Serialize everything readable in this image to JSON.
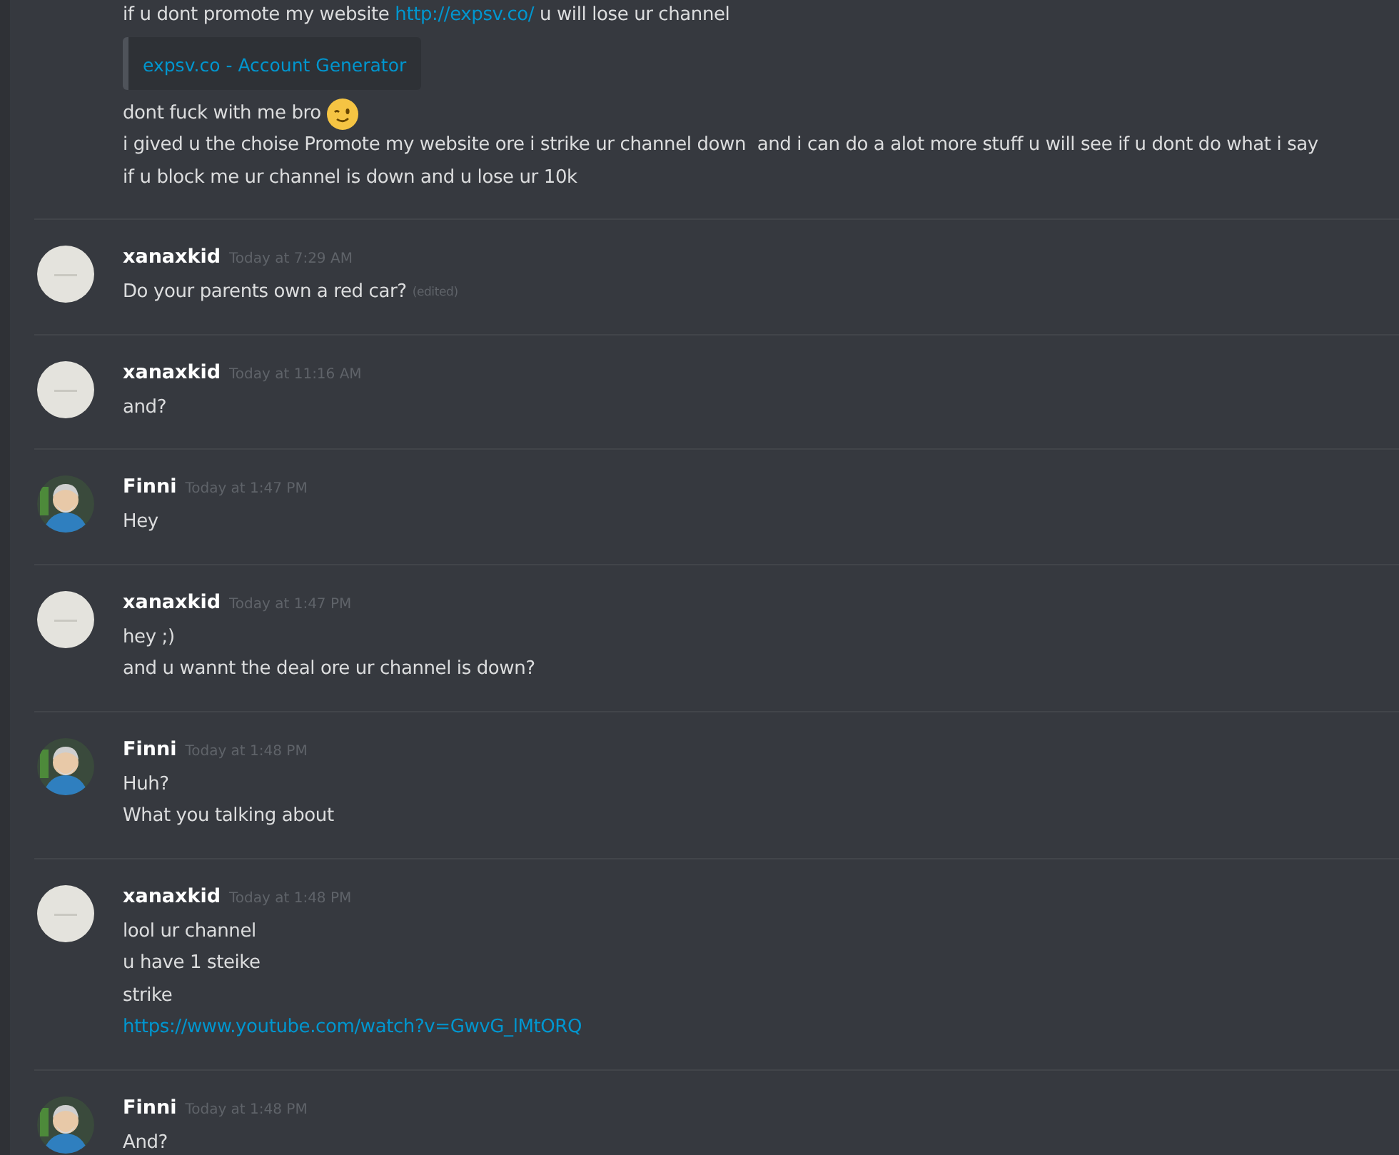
{
  "messages": [
    {
      "lines": [
        {
          "kind": "text",
          "parts": [
            {
              "text": "if u dont promote my website ",
              "link": false
            },
            {
              "text": "http://expsv.co/",
              "link": true
            },
            {
              "text": " u will lose ur channel",
              "link": false
            }
          ]
        },
        {
          "kind": "embed",
          "title": "expsv.co - Account Generator"
        },
        {
          "kind": "text",
          "parts": [
            {
              "text": "dont fuck with me bro",
              "link": false
            },
            {
              "kind": "emoji"
            }
          ]
        },
        {
          "kind": "text",
          "parts": [
            {
              "text": "i gived u the choise Promote my website ore i strike ur channel down  and i can do a alot more stuff u will see if u dont do what i say",
              "link": false
            }
          ]
        },
        {
          "kind": "text",
          "parts": [
            {
              "text": "if u block me ur channel is down and u lose ur 10k",
              "link": false
            }
          ]
        }
      ]
    },
    {
      "author": "xanaxkid",
      "avatar": {
        "kind": "blank"
      },
      "time": "Today at 7:29 AM",
      "lines": [
        {
          "kind": "text",
          "parts": [
            {
              "text": "Do your parents own a red car?",
              "link": false
            }
          ],
          "edited": "(edited)"
        }
      ]
    },
    {
      "author": "xanaxkid",
      "avatar": {
        "kind": "blank"
      },
      "time": "Today at 11:16 AM",
      "lines": [
        {
          "kind": "text",
          "parts": [
            {
              "text": "and?",
              "link": false
            }
          ]
        }
      ]
    },
    {
      "author": "Finni",
      "avatar": {
        "kind": "figure"
      },
      "time": "Today at 1:47 PM",
      "lines": [
        {
          "kind": "text",
          "parts": [
            {
              "text": "Hey",
              "link": false
            }
          ]
        }
      ]
    },
    {
      "author": "xanaxkid",
      "avatar": {
        "kind": "blank"
      },
      "time": "Today at 1:47 PM",
      "lines": [
        {
          "kind": "text",
          "parts": [
            {
              "text": "hey ;)",
              "link": false
            }
          ]
        },
        {
          "kind": "text",
          "parts": [
            {
              "text": "and u wannt the deal ore ur channel is down?",
              "link": false
            }
          ]
        }
      ]
    },
    {
      "author": "Finni",
      "avatar": {
        "kind": "figure"
      },
      "time": "Today at 1:48 PM",
      "lines": [
        {
          "kind": "text",
          "parts": [
            {
              "text": "Huh?",
              "link": false
            }
          ]
        },
        {
          "kind": "text",
          "parts": [
            {
              "text": "What you talking about",
              "link": false
            }
          ]
        }
      ]
    },
    {
      "author": "xanaxkid",
      "avatar": {
        "kind": "blank"
      },
      "time": "Today at 1:48 PM",
      "lines": [
        {
          "kind": "text",
          "parts": [
            {
              "text": "lool ur channel",
              "link": false
            }
          ]
        },
        {
          "kind": "text",
          "parts": [
            {
              "text": "u have 1 steike",
              "link": false
            }
          ]
        },
        {
          "kind": "text",
          "parts": [
            {
              "text": "strike",
              "link": false
            }
          ]
        },
        {
          "kind": "text",
          "parts": [
            {
              "text": "https://www.youtube.com/watch?v=GwvG_lMtORQ",
              "link": true
            }
          ]
        }
      ]
    },
    {
      "author": "Finni",
      "avatar": {
        "kind": "figure"
      },
      "time": "Today at 1:48 PM",
      "lines": [
        {
          "kind": "text",
          "parts": [
            {
              "text": "And?",
              "link": false
            }
          ]
        }
      ]
    }
  ]
}
